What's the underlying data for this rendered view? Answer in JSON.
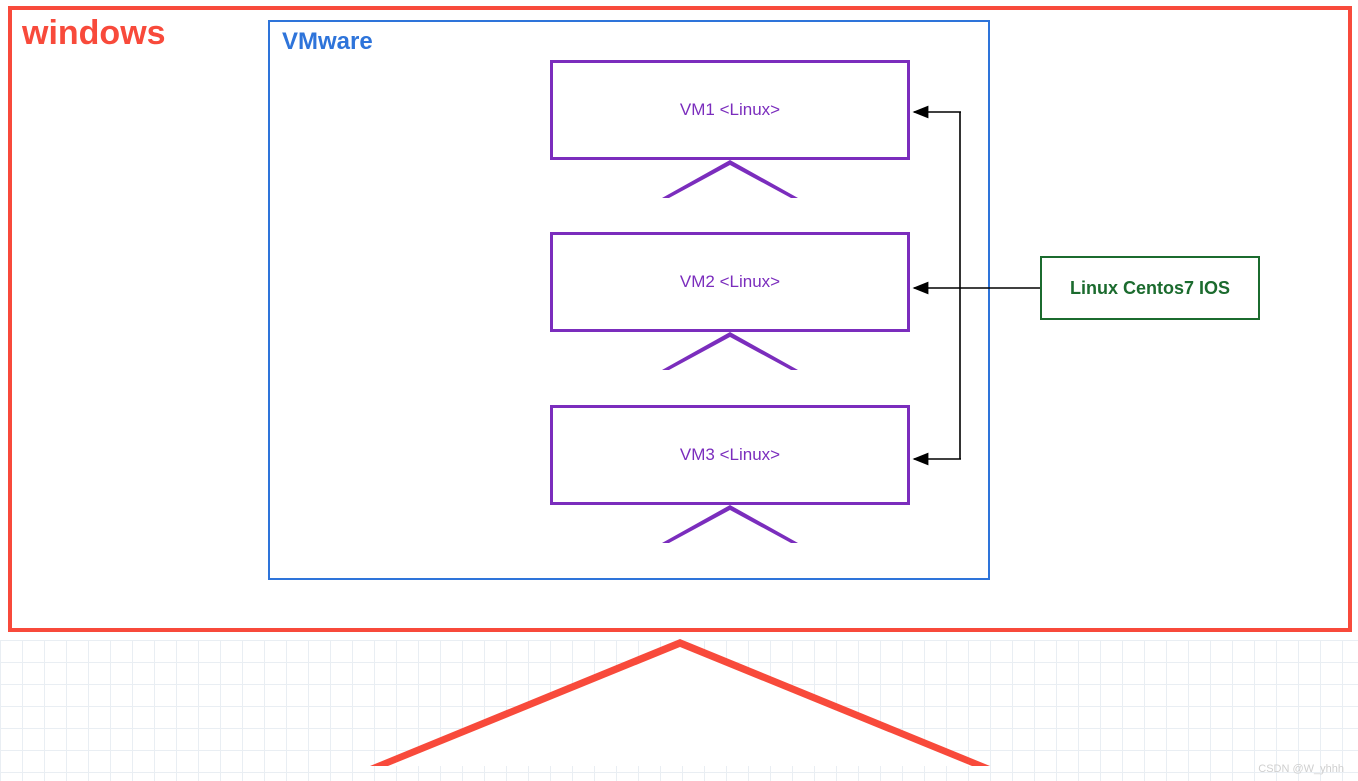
{
  "outer": {
    "title": "windows"
  },
  "vmware": {
    "title": "VMware"
  },
  "vms": [
    {
      "label": "VM1 <Linux>"
    },
    {
      "label": "VM2 <Linux>"
    },
    {
      "label": "VM3 <Linux>"
    }
  ],
  "iso": {
    "label": "Linux Centos7 IOS"
  },
  "watermark": "CSDN @W_yhhh",
  "colors": {
    "red": "#F84A3B",
    "blue": "#2E74DA",
    "purple": "#7B2DBD",
    "green": "#1B6B2E"
  }
}
